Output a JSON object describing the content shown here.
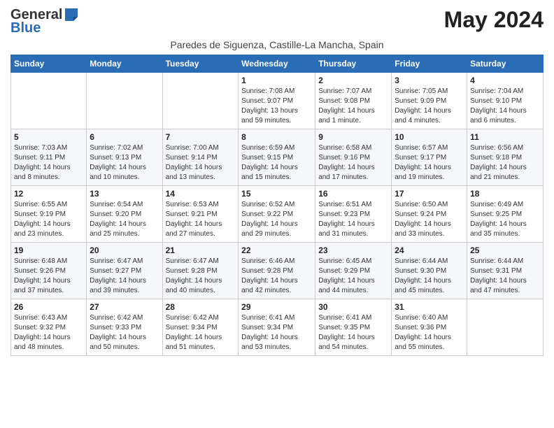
{
  "header": {
    "logo_general": "General",
    "logo_blue": "Blue",
    "month_title": "May 2024",
    "subtitle": "Paredes de Siguenza, Castille-La Mancha, Spain"
  },
  "weekdays": [
    "Sunday",
    "Monday",
    "Tuesday",
    "Wednesday",
    "Thursday",
    "Friday",
    "Saturday"
  ],
  "weeks": [
    [
      {
        "day": "",
        "info": ""
      },
      {
        "day": "",
        "info": ""
      },
      {
        "day": "",
        "info": ""
      },
      {
        "day": "1",
        "info": "Sunrise: 7:08 AM\nSunset: 9:07 PM\nDaylight: 13 hours\nand 59 minutes."
      },
      {
        "day": "2",
        "info": "Sunrise: 7:07 AM\nSunset: 9:08 PM\nDaylight: 14 hours\nand 1 minute."
      },
      {
        "day": "3",
        "info": "Sunrise: 7:05 AM\nSunset: 9:09 PM\nDaylight: 14 hours\nand 4 minutes."
      },
      {
        "day": "4",
        "info": "Sunrise: 7:04 AM\nSunset: 9:10 PM\nDaylight: 14 hours\nand 6 minutes."
      }
    ],
    [
      {
        "day": "5",
        "info": "Sunrise: 7:03 AM\nSunset: 9:11 PM\nDaylight: 14 hours\nand 8 minutes."
      },
      {
        "day": "6",
        "info": "Sunrise: 7:02 AM\nSunset: 9:13 PM\nDaylight: 14 hours\nand 10 minutes."
      },
      {
        "day": "7",
        "info": "Sunrise: 7:00 AM\nSunset: 9:14 PM\nDaylight: 14 hours\nand 13 minutes."
      },
      {
        "day": "8",
        "info": "Sunrise: 6:59 AM\nSunset: 9:15 PM\nDaylight: 14 hours\nand 15 minutes."
      },
      {
        "day": "9",
        "info": "Sunrise: 6:58 AM\nSunset: 9:16 PM\nDaylight: 14 hours\nand 17 minutes."
      },
      {
        "day": "10",
        "info": "Sunrise: 6:57 AM\nSunset: 9:17 PM\nDaylight: 14 hours\nand 19 minutes."
      },
      {
        "day": "11",
        "info": "Sunrise: 6:56 AM\nSunset: 9:18 PM\nDaylight: 14 hours\nand 21 minutes."
      }
    ],
    [
      {
        "day": "12",
        "info": "Sunrise: 6:55 AM\nSunset: 9:19 PM\nDaylight: 14 hours\nand 23 minutes."
      },
      {
        "day": "13",
        "info": "Sunrise: 6:54 AM\nSunset: 9:20 PM\nDaylight: 14 hours\nand 25 minutes."
      },
      {
        "day": "14",
        "info": "Sunrise: 6:53 AM\nSunset: 9:21 PM\nDaylight: 14 hours\nand 27 minutes."
      },
      {
        "day": "15",
        "info": "Sunrise: 6:52 AM\nSunset: 9:22 PM\nDaylight: 14 hours\nand 29 minutes."
      },
      {
        "day": "16",
        "info": "Sunrise: 6:51 AM\nSunset: 9:23 PM\nDaylight: 14 hours\nand 31 minutes."
      },
      {
        "day": "17",
        "info": "Sunrise: 6:50 AM\nSunset: 9:24 PM\nDaylight: 14 hours\nand 33 minutes."
      },
      {
        "day": "18",
        "info": "Sunrise: 6:49 AM\nSunset: 9:25 PM\nDaylight: 14 hours\nand 35 minutes."
      }
    ],
    [
      {
        "day": "19",
        "info": "Sunrise: 6:48 AM\nSunset: 9:26 PM\nDaylight: 14 hours\nand 37 minutes."
      },
      {
        "day": "20",
        "info": "Sunrise: 6:47 AM\nSunset: 9:27 PM\nDaylight: 14 hours\nand 39 minutes."
      },
      {
        "day": "21",
        "info": "Sunrise: 6:47 AM\nSunset: 9:28 PM\nDaylight: 14 hours\nand 40 minutes."
      },
      {
        "day": "22",
        "info": "Sunrise: 6:46 AM\nSunset: 9:28 PM\nDaylight: 14 hours\nand 42 minutes."
      },
      {
        "day": "23",
        "info": "Sunrise: 6:45 AM\nSunset: 9:29 PM\nDaylight: 14 hours\nand 44 minutes."
      },
      {
        "day": "24",
        "info": "Sunrise: 6:44 AM\nSunset: 9:30 PM\nDaylight: 14 hours\nand 45 minutes."
      },
      {
        "day": "25",
        "info": "Sunrise: 6:44 AM\nSunset: 9:31 PM\nDaylight: 14 hours\nand 47 minutes."
      }
    ],
    [
      {
        "day": "26",
        "info": "Sunrise: 6:43 AM\nSunset: 9:32 PM\nDaylight: 14 hours\nand 48 minutes."
      },
      {
        "day": "27",
        "info": "Sunrise: 6:42 AM\nSunset: 9:33 PM\nDaylight: 14 hours\nand 50 minutes."
      },
      {
        "day": "28",
        "info": "Sunrise: 6:42 AM\nSunset: 9:34 PM\nDaylight: 14 hours\nand 51 minutes."
      },
      {
        "day": "29",
        "info": "Sunrise: 6:41 AM\nSunset: 9:34 PM\nDaylight: 14 hours\nand 53 minutes."
      },
      {
        "day": "30",
        "info": "Sunrise: 6:41 AM\nSunset: 9:35 PM\nDaylight: 14 hours\nand 54 minutes."
      },
      {
        "day": "31",
        "info": "Sunrise: 6:40 AM\nSunset: 9:36 PM\nDaylight: 14 hours\nand 55 minutes."
      },
      {
        "day": "",
        "info": ""
      }
    ]
  ]
}
